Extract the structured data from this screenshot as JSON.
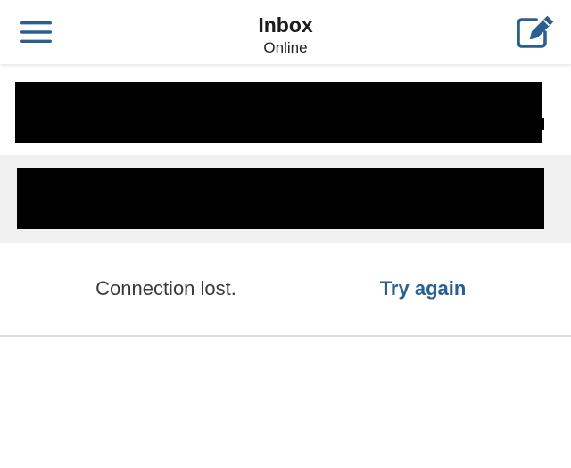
{
  "header": {
    "title": "Inbox",
    "subtitle": "Online",
    "menu_icon": "hamburger-menu-icon",
    "compose_icon": "compose-icon"
  },
  "messages": [
    {
      "content": "redacted"
    },
    {
      "content": "redacted"
    }
  ],
  "connection": {
    "status_text": "Connection lost.",
    "retry_label": "Try again"
  },
  "colors": {
    "accent": "#2a5f8f",
    "header_bg": "#ffffff",
    "row_alt_bg": "#f1f1f2",
    "text_dark": "#1c1c1e",
    "text_secondary": "#3a3a3c"
  }
}
